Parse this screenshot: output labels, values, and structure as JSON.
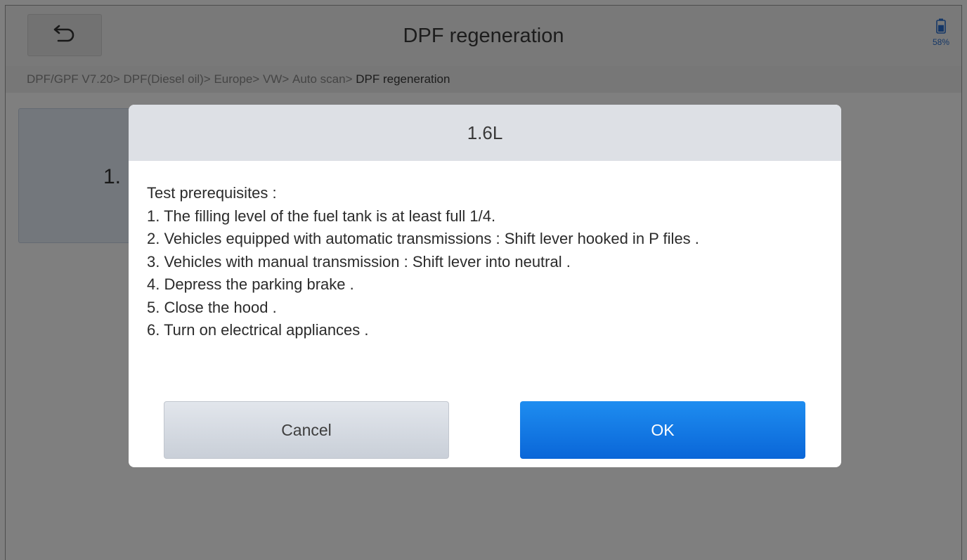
{
  "header": {
    "title": "DPF regeneration",
    "back_icon": "back-arrow-icon"
  },
  "status": {
    "battery_icon": "battery-icon",
    "battery_percent": "58%",
    "battery_level": 0.58,
    "accent_color": "#2a6fcf"
  },
  "breadcrumb": {
    "items": [
      "DPF/GPF V7.20>",
      "DPF(Diesel oil)>",
      "Europe>",
      "VW>",
      "Auto scan>"
    ],
    "current": "DPF regeneration"
  },
  "background_tile": {
    "label": "1."
  },
  "dialog": {
    "title": "1.6L",
    "lines": [
      "Test prerequisites :",
      "1. The filling level of the fuel tank is at least full 1/4.",
      "2. Vehicles equipped with automatic transmissions : Shift lever hooked in P files .",
      "3. Vehicles with manual transmission : Shift lever into neutral .",
      "4. Depress the parking brake .",
      "5. Close the hood .",
      "6. Turn on electrical appliances ."
    ],
    "cancel_label": "Cancel",
    "ok_label": "OK",
    "ok_color": "#1a7fe8"
  }
}
